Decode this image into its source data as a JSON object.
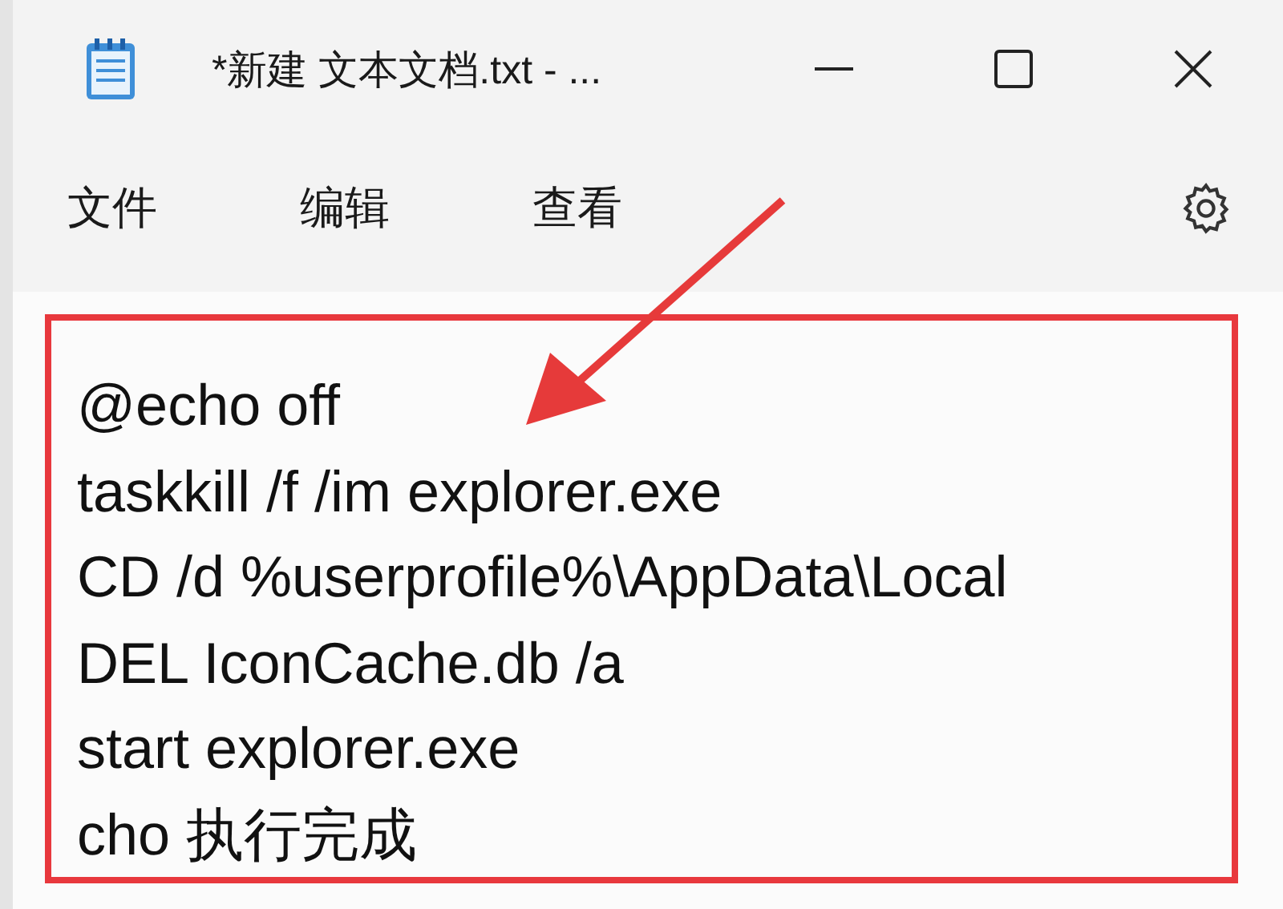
{
  "window": {
    "title": "*新建 文本文档.txt - ..."
  },
  "menu": [
    {
      "label": "文件"
    },
    {
      "label": "编辑"
    },
    {
      "label": "查看"
    }
  ],
  "editor": {
    "lines": [
      "@echo off",
      "taskkill /f /im explorer.exe",
      "CD /d %userprofile%\\AppData\\Local",
      "DEL IconCache.db /a",
      "start explorer.exe",
      "cho 执行完成"
    ]
  }
}
